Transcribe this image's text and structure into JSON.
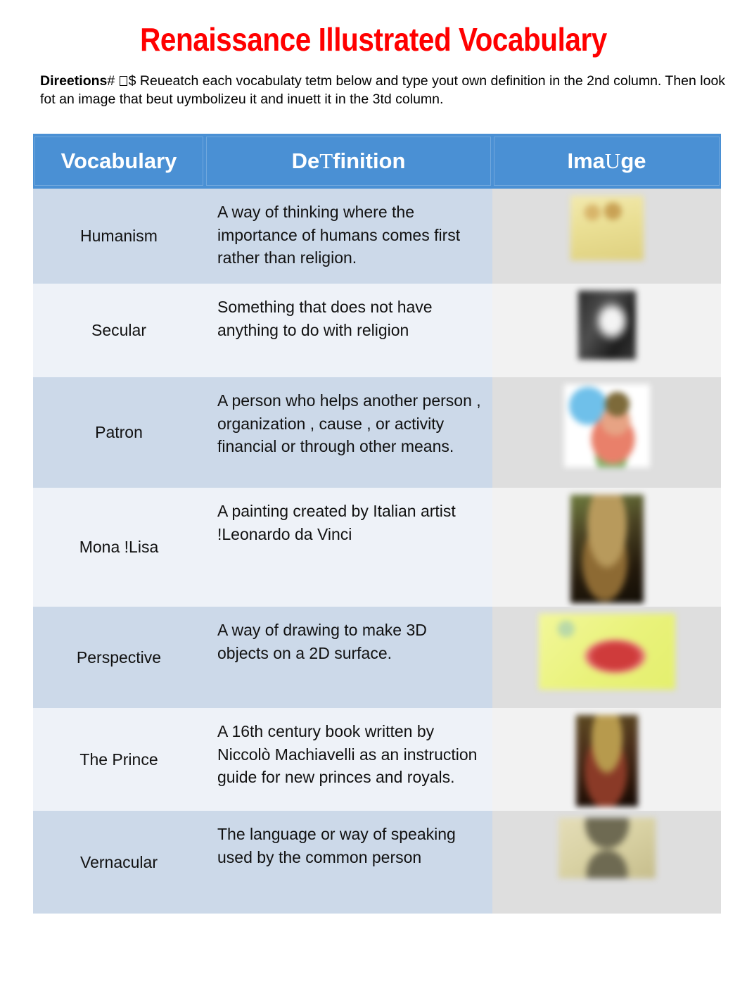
{
  "document": {
    "title": "Renaissance Illustrated Vocabulary",
    "title_color": "#ff0000",
    "directions": {
      "label": "Direetions",
      "after_label": "# ",
      "tofu_glyph": "missing-glyph-box",
      "rest": "$ Reueatch each vocabulaty tetm below and type yout own definition in the 2nd column. Then look fot an image that beut uymbolizeu it and inuett it in the 3td column."
    }
  },
  "table": {
    "header_bg": "#4a90d4",
    "header_text_color": "#ffffff",
    "row_band_a_bg": "#ccd9e9",
    "row_band_b_bg": "#eef2f8",
    "columns": [
      {
        "key": "vocabulary",
        "label_plain": "Vocabulary",
        "label_a": "Vocabulary",
        "label_serif": "",
        "label_b": ""
      },
      {
        "key": "definition",
        "label_plain": "DeTfinition",
        "label_a": "De",
        "label_serif": "T",
        "label_b": "finition"
      },
      {
        "key": "image",
        "label_plain": "ImaUge",
        "label_a": "Ima",
        "label_serif": "U",
        "label_b": "ge"
      }
    ],
    "rows": [
      {
        "vocabulary": "Humanism",
        "definition": "A way of thinking where the importance of humans comes first rather than religion.",
        "image_alt": "pale-yellow-illustration"
      },
      {
        "vocabulary": "Secular",
        "definition": "Something that does not have anything to do with religion",
        "image_alt": "black-and-white-photo"
      },
      {
        "vocabulary": "Patron",
        "definition": "A person who helps another person , organization , cause , or activity financial or through other means.",
        "image_alt": "cartoon-figure-illustration"
      },
      {
        "vocabulary": "Mona !Lisa",
        "definition": "A painting created by Italian artist !Leonardo da Vinci",
        "image_alt": "mona-lisa-painting"
      },
      {
        "vocabulary": "Perspective",
        "definition": "A way of drawing to make 3D objects on a 2D surface.",
        "image_alt": "yellow-perspective-diagram"
      },
      {
        "vocabulary": "The Prince",
        "definition": "A 16th century book written by Niccolò Machiavelli as an instruction guide for new princes and royals.",
        "image_alt": "the-prince-book-cover"
      },
      {
        "vocabulary": "Vernacular",
        "definition": "The language or way of speaking used by the common person",
        "image_alt": "old-manuscript-parchment"
      }
    ]
  }
}
